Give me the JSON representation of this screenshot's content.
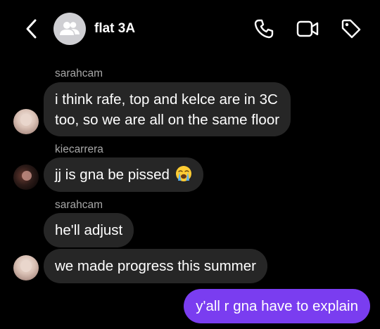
{
  "header": {
    "title": "flat 3A",
    "icons": {
      "back": "chevron-left-icon",
      "group": "group-avatar-icon",
      "call": "phone-icon",
      "video": "video-camera-icon",
      "tag": "tag-icon"
    }
  },
  "messages": [
    {
      "sender": "sarahcam",
      "lines": [
        "i think rafe, top and kelce are in 3C",
        "too, so we are all on the same floor"
      ]
    },
    {
      "sender": "kiecarrera",
      "text": "jj is gna be pissed",
      "emoji": "loudly-crying-face-emoji"
    },
    {
      "sender": "sarahcam",
      "text": "he'll adjust"
    },
    {
      "text": "we made progress this summer"
    },
    {
      "outgoing": true,
      "text": "y'all r gna have to explain"
    }
  ],
  "colors": {
    "background": "#000000",
    "incoming_bubble": "#262626",
    "outgoing_bubble": "#7a3df0",
    "sender_name": "#a8a8a8"
  }
}
